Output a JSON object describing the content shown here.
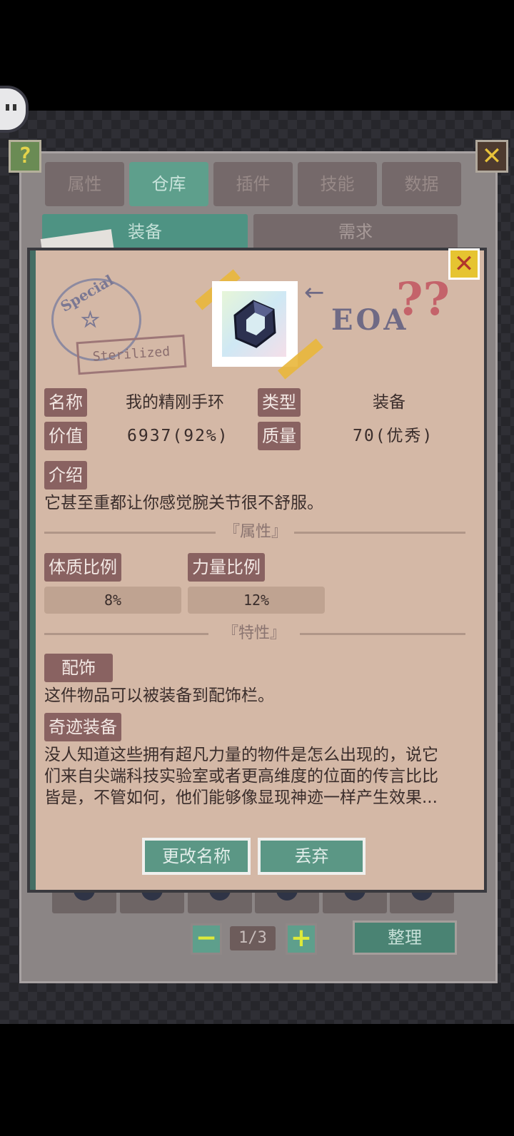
{
  "tabs": [
    {
      "label": "属性"
    },
    {
      "label": "仓库",
      "active": true
    },
    {
      "label": "插件"
    },
    {
      "label": "技能"
    },
    {
      "label": "数据"
    }
  ],
  "subtabs": [
    {
      "label": "装备",
      "active": true
    },
    {
      "label": "需求"
    }
  ],
  "top_buttons": {
    "help": "?",
    "close": "✕"
  },
  "item": {
    "stamp_text": "Special",
    "sterilized_text": "Sterilized",
    "tag_text": "EOA",
    "qmarks": "??",
    "name_label": "名称",
    "name": "我的精刚手环",
    "type_label": "类型",
    "type": "装备",
    "value_label": "价值",
    "value": "6937(92%)",
    "quality_label": "质量",
    "quality": "70(优秀)",
    "intro_label": "介绍",
    "intro": "它甚至重都让你感觉腕关节很不舒服。",
    "attributes_title": "『属性』",
    "attributes": [
      {
        "label": "体质比例",
        "value": "8%"
      },
      {
        "label": "力量比例",
        "value": "12%"
      }
    ],
    "traits_title": "『特性』",
    "traits": [
      {
        "label": "配饰",
        "lines": [
          "这件物品可以被装备到配饰栏。"
        ]
      },
      {
        "label": "奇迹装备",
        "lines": [
          "没人知道这些拥有超凡力量的物件是怎么出现的，说它",
          "们来自尖端科技实验室或者更高维度的位面的传言比比",
          "皆是，不管如何，他们能够像显现神迹一样产生效果..."
        ]
      }
    ],
    "rename_button": "更改名称",
    "discard_button": "丢弃",
    "close": "✕"
  },
  "pagination": {
    "prev": "−",
    "page": "1/3",
    "next": "+"
  },
  "sort_button": "整理",
  "colors": {
    "accent_teal": "#5e9f8c",
    "label_brown": "#896261",
    "panel_bg": "#d4b8a6"
  }
}
